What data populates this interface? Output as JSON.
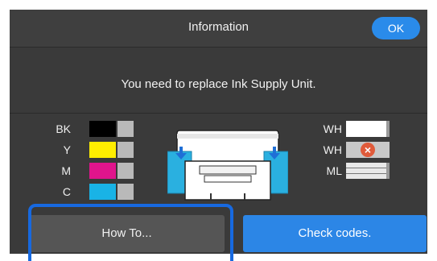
{
  "dialog": {
    "title": "Information",
    "ok_label": "OK",
    "message": "You need to replace Ink Supply Unit."
  },
  "ink_left": [
    {
      "label": "BK",
      "color": "#000000"
    },
    {
      "label": "Y",
      "color": "#ffee00"
    },
    {
      "label": "M",
      "color": "#e0148c"
    },
    {
      "label": "C",
      "color": "#19b3e6"
    }
  ],
  "ink_right": [
    {
      "label": "WH",
      "state": "normal"
    },
    {
      "label": "WH",
      "state": "error"
    },
    {
      "label": "ML",
      "state": "normal"
    }
  ],
  "buttons": {
    "how_to": "How To...",
    "check_codes": "Check codes."
  },
  "colors": {
    "accent": "#2a8bea",
    "highlight": "#1769e0",
    "error": "#e05a3a"
  },
  "icons": {
    "error": "error-x-icon",
    "printer": "printer-illustration",
    "arrow": "down-arrow-icon"
  }
}
